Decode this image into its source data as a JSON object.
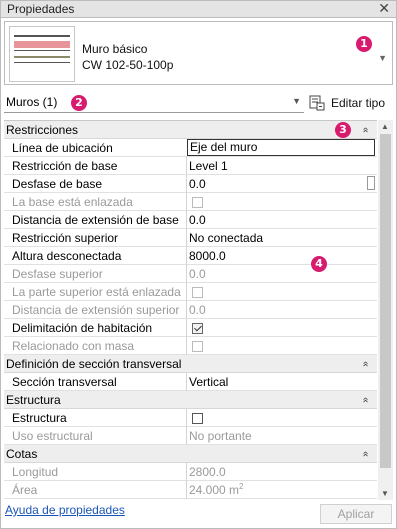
{
  "window": {
    "title": "Propiedades",
    "close_glyph": "✕"
  },
  "type_selector": {
    "family": "Muro básico",
    "type": "CW 102-50-100p",
    "dropdown_glyph": "▼"
  },
  "filter": {
    "value": "Muros (1)",
    "dropdown_glyph": "▼"
  },
  "edit_type": {
    "label": "Editar tipo",
    "icon": "edit-type-icon"
  },
  "badges": {
    "b1": "1",
    "b2": "2",
    "b3": "3",
    "b4": "4",
    "color": "#d81b6e"
  },
  "chevron": "»",
  "sections": {
    "restricciones": {
      "title": "Restricciones"
    },
    "seccion": {
      "title": "Definición de sección transversal"
    },
    "estructura": {
      "title": "Estructura"
    },
    "cotas": {
      "title": "Cotas"
    }
  },
  "props": {
    "linea_ubicacion": {
      "name": "Línea de ubicación",
      "value": "Eje del muro"
    },
    "restriccion_base": {
      "name": "Restricción de base",
      "value": "Level 1"
    },
    "desfase_base": {
      "name": "Desfase de base",
      "value": "0.0"
    },
    "base_enlazada": {
      "name": "La base está enlazada"
    },
    "dist_ext_base": {
      "name": "Distancia de extensión de base",
      "value": "0.0"
    },
    "restriccion_superior": {
      "name": "Restricción superior",
      "value": "No conectada"
    },
    "altura_desconectada": {
      "name": "Altura desconectada",
      "value": "8000.0"
    },
    "desfase_superior": {
      "name": "Desfase superior",
      "value": "0.0"
    },
    "superior_enlazada": {
      "name": "La parte superior está enlazada"
    },
    "dist_ext_superior": {
      "name": "Distancia de extensión superior",
      "value": "0.0"
    },
    "delimitacion": {
      "name": "Delimitación de habitación",
      "checked": true
    },
    "relacionado_masa": {
      "name": "Relacionado con masa"
    },
    "seccion_transversal": {
      "name": "Sección transversal",
      "value": "Vertical"
    },
    "estructura": {
      "name": "Estructura"
    },
    "uso_estructural": {
      "name": "Uso estructural",
      "value": "No portante"
    },
    "longitud": {
      "name": "Longitud",
      "value": "2800.0"
    },
    "area": {
      "name": "Área",
      "value": "24.000 m",
      "unit_sup": "2"
    }
  },
  "footer": {
    "help_link": "Ayuda de propiedades",
    "apply_label": "Aplicar"
  },
  "scroll": {
    "up": "▲",
    "down": "▼"
  }
}
